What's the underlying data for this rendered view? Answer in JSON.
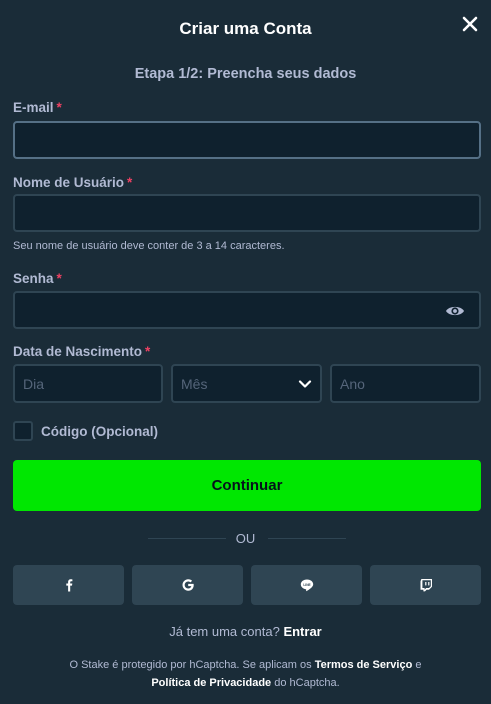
{
  "modal": {
    "title": "Criar uma Conta",
    "step_text": "Etapa 1/2: Preencha seus dados"
  },
  "form": {
    "email_label": "E-mail",
    "email_value": "",
    "username_label": "Nome de Usuário",
    "username_value": "",
    "username_hint": "Seu nome de usuário deve conter de 3 a 14 caracteres.",
    "password_label": "Senha",
    "password_value": "",
    "birthdate_label": "Data de Nascimento",
    "day_placeholder": "Dia",
    "month_placeholder": "Mês",
    "year_placeholder": "Ano",
    "code_label": "Código (Opcional)",
    "code_checked": false,
    "required_mark": "*"
  },
  "actions": {
    "continue_label": "Continuar",
    "divider_text": "OU"
  },
  "social": {
    "buttons": [
      "facebook-icon",
      "google-icon",
      "line-icon",
      "twitch-icon"
    ]
  },
  "footer": {
    "have_account_text": "Já tem uma conta?",
    "login_link": "Entrar",
    "legal_prefix": "O Stake é protegido por hCaptcha. Se aplicam os",
    "terms_link": "Termos de Serviço",
    "legal_and": "e",
    "privacy_link": "Política de Privacidade",
    "legal_suffix": "do hCaptcha."
  },
  "colors": {
    "background": "#1a2c38",
    "input_bg": "#0f212e",
    "border": "#2f4553",
    "accent_green": "#00e701",
    "required_red": "#ed4163",
    "text": "#b1bad3"
  }
}
